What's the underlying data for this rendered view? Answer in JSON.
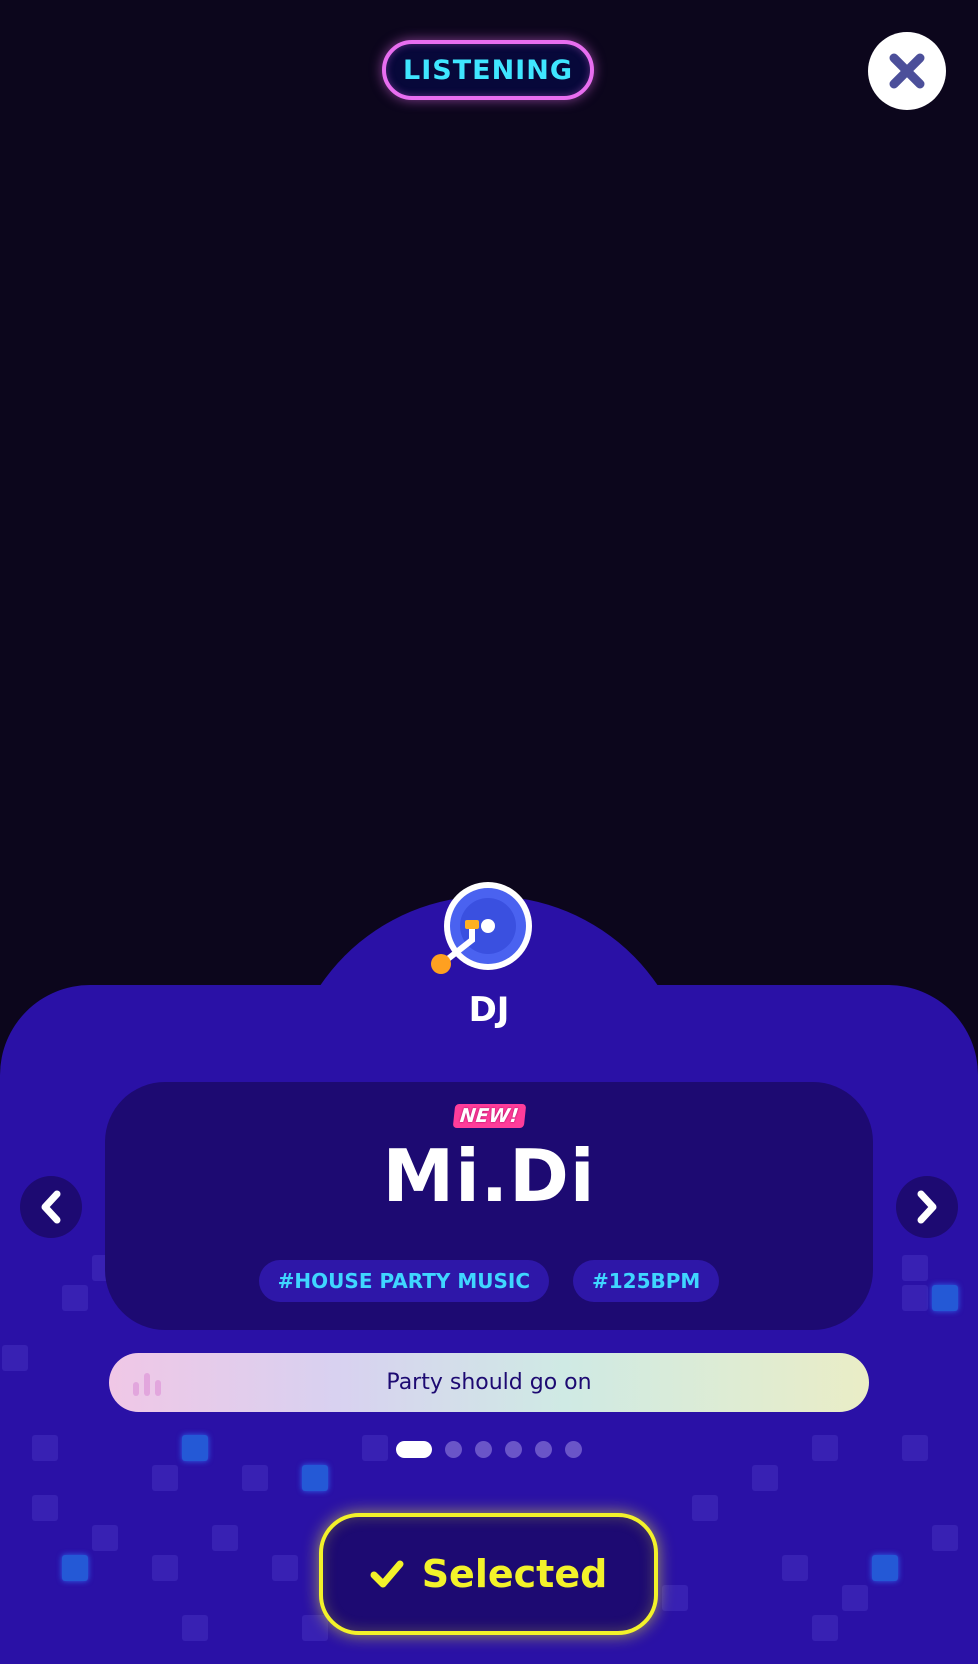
{
  "header": {
    "mode_badge": "LISTENING",
    "close_icon": "close-icon"
  },
  "category": {
    "label": "DJ",
    "icon": "turntable-icon"
  },
  "song": {
    "new_tag": "NEW!",
    "title": "Mi.Di",
    "tags": [
      "#HOUSE PARTY MUSIC",
      "#125BPM"
    ]
  },
  "navigation": {
    "prev_icon": "chevron-left-icon",
    "next_icon": "chevron-right-icon"
  },
  "now_playing": {
    "icon": "equalizer-bars-icon",
    "track_name": "Party should go on"
  },
  "pager": {
    "total": 6,
    "current": 1
  },
  "action": {
    "label": "Selected",
    "icon": "check-icon"
  },
  "colors": {
    "background": "#0c061c",
    "panel": "#2a11a6",
    "card": "#1d0a72",
    "neon_cyan": "#3fe6ff",
    "neon_pink": "#e86ef0",
    "neon_yellow": "#f3f22a"
  }
}
